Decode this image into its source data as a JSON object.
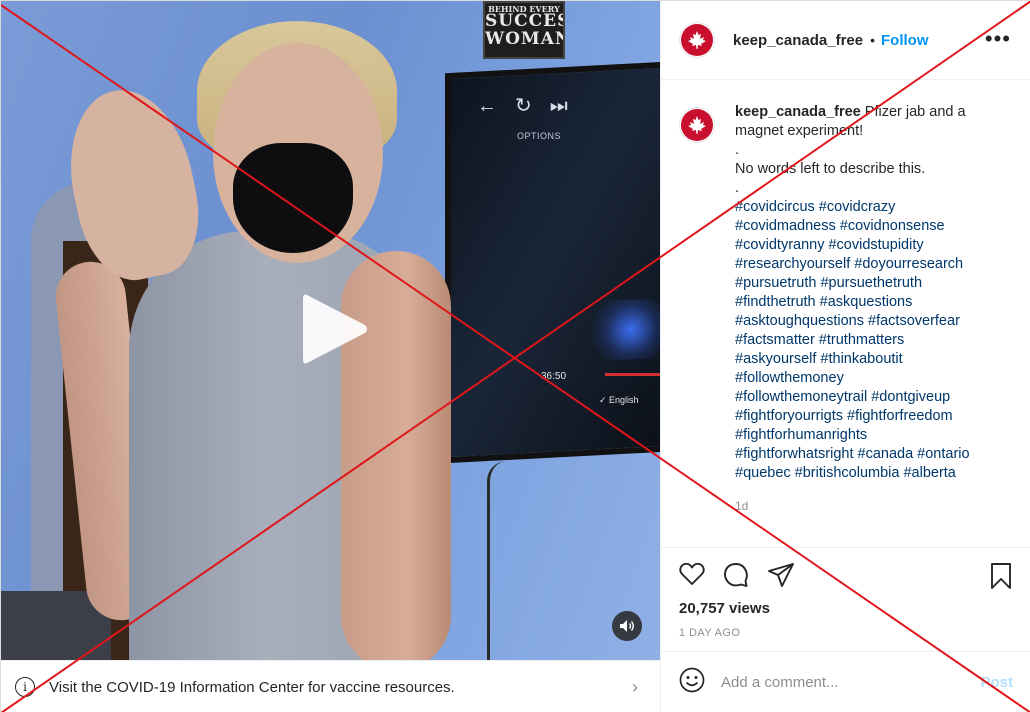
{
  "media": {
    "play_icon": "play-icon",
    "sound_icon": "speaker-icon",
    "scene_text": {
      "poster_line1": "BEHIND EVERY",
      "poster_line2": "SUCCESSFUL",
      "poster_line3": "WOMAN",
      "tv_options": "OPTIONS",
      "tv_time": "36:50",
      "tv_language": "✓ English"
    }
  },
  "info_bar": {
    "icon": "info-icon",
    "text": "Visit the COVID-19 Information Center for vaccine resources."
  },
  "header": {
    "username": "keep_canada_free",
    "separator": "•",
    "follow_label": "Follow",
    "more_icon": "more-options-icon"
  },
  "caption": {
    "username": "keep_canada_free",
    "text_first": "Pfizer jab and a magnet experiment!",
    "lines": [
      ".",
      "No words left to describe this.",
      "."
    ],
    "hashtag_lines": [
      "#covidcircus #covidcrazy",
      "#covidmadness #covidnonsense",
      "#covidtyranny #covidstupidity",
      "#researchyourself #doyourresearch",
      "#pursuetruth #pursuethetruth",
      "#findthetruth #askquestions",
      "#asktoughquestions #factsoverfear",
      "#factsmatter #truthmatters",
      "#askyourself #thinkaboutit",
      "#followthemoney",
      "#followthemoneytrail #dontgiveup",
      "#fightforyourrigts #fightforfreedom",
      "#fightforhumanrights",
      "#fightforwhatsright #canada #ontario",
      "#quebec #britishcolumbia #alberta"
    ],
    "time_ago": "1d"
  },
  "actions": {
    "like_icon": "heart-icon",
    "comment_icon": "comment-icon",
    "share_icon": "share-icon",
    "save_icon": "bookmark-icon"
  },
  "stats": {
    "views": "20,757 views",
    "date": "1 DAY AGO"
  },
  "comment": {
    "emoji_icon": "emoji-icon",
    "placeholder": "Add a comment...",
    "post_label": "Post"
  },
  "colors": {
    "link_blue": "#0095f6",
    "hashtag": "#00376b",
    "overlay_x": "#e0161b",
    "avatar_red": "#c8102e"
  }
}
